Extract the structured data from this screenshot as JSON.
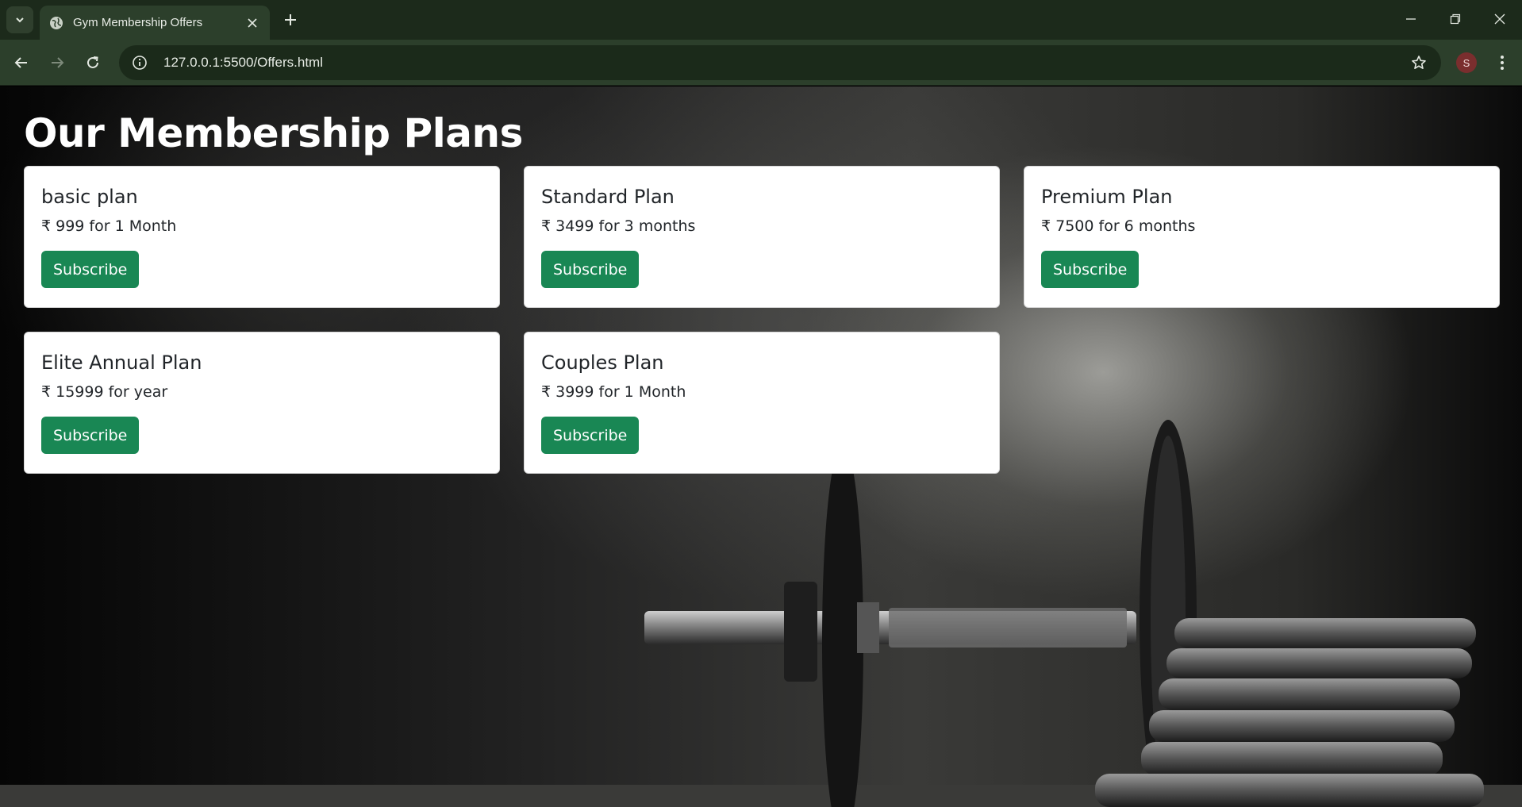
{
  "browser": {
    "tab_title": "Gym Membership Offers",
    "url": "127.0.0.1:5500/Offers.html",
    "profile_initial": "S"
  },
  "page": {
    "title": "Our Membership Plans",
    "plans": [
      {
        "name": "basic plan",
        "price": "₹ 999 for 1 Month",
        "button": "Subscribe"
      },
      {
        "name": "Standard Plan",
        "price": "₹ 3499 for 3 months",
        "button": "Subscribe"
      },
      {
        "name": "Premium Plan",
        "price": "₹ 7500 for 6 months",
        "button": "Subscribe"
      },
      {
        "name": "Elite Annual Plan",
        "price": "₹ 15999 for year",
        "button": "Subscribe"
      },
      {
        "name": "Couples Plan",
        "price": "₹ 3999 for 1 Month",
        "button": "Subscribe"
      }
    ]
  },
  "colors": {
    "button": "#198754",
    "chrome_tabbar": "#1c2a1b",
    "chrome_toolbar": "#2c3f2b"
  }
}
